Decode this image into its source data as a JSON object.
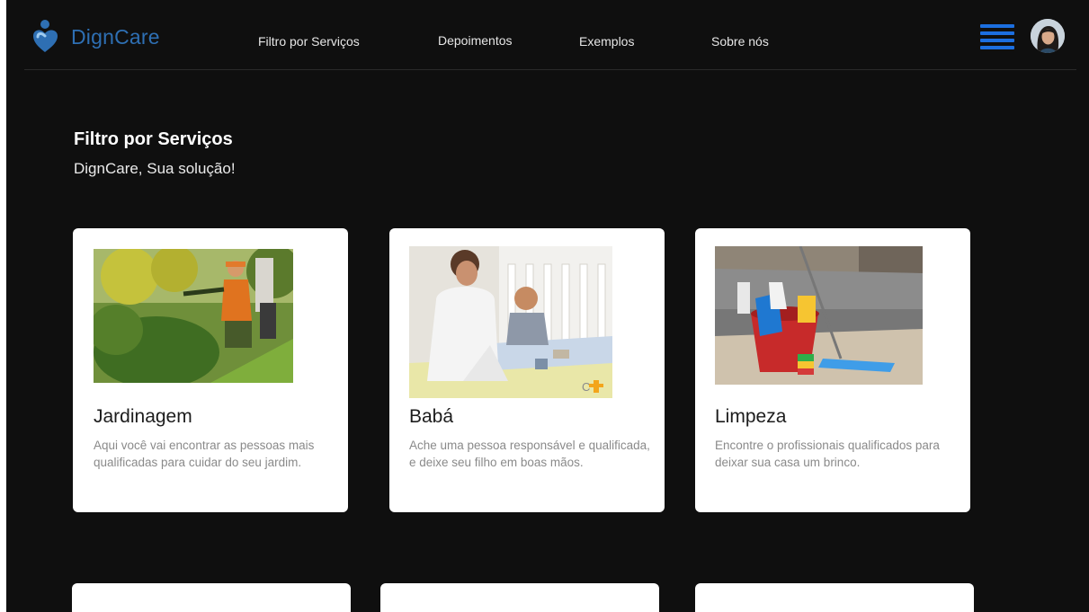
{
  "brand": {
    "name": "DignCare",
    "logo_icon": "heart-person-icon",
    "color": "#2e6fb3"
  },
  "nav": {
    "items": [
      {
        "label": "Filtro por Serviços"
      },
      {
        "label": "Depoimentos"
      },
      {
        "label": "Exemplos"
      },
      {
        "label": "Sobre nós"
      }
    ]
  },
  "header_actions": {
    "menu_icon": "hamburger-menu-icon",
    "menu_color": "#1c6fe0",
    "avatar_icon": "user-avatar"
  },
  "section": {
    "title": "Filtro por Serviços",
    "subtitle": "DignCare, Sua solução!"
  },
  "cards": [
    {
      "title": "Jardinagem",
      "description": "Aqui você vai encontrar as pessoas mais qualificadas para cuidar do seu jardim.",
      "image": "gardener-photo"
    },
    {
      "title": "Babá",
      "description": "Ache uma pessoa responsável e qualificada, e deixe seu filho em boas mãos.",
      "image": "nanny-with-baby-photo"
    },
    {
      "title": "Limpeza",
      "description": "Encontre o profissionais qualificados para deixar sua casa um brinco.",
      "image": "cleaning-supplies-photo"
    }
  ],
  "colors": {
    "background": "#0f0f0f",
    "card": "#ffffff",
    "text_muted": "#8a8a8a"
  }
}
